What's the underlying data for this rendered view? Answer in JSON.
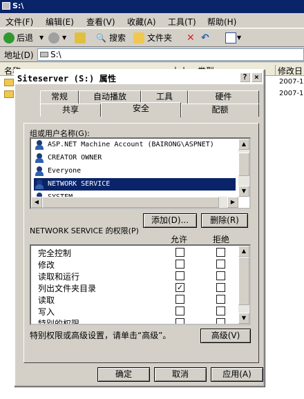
{
  "explorer": {
    "title": "S:\\",
    "menu": [
      "文件(F)",
      "编辑(E)",
      "查看(V)",
      "收藏(A)",
      "工具(T)",
      "帮助(H)"
    ],
    "toolbar": {
      "back": "后退",
      "search": "搜索",
      "folders": "文件夹"
    },
    "address_label": "地址(D)",
    "address_value": "S:\\",
    "columns": {
      "name": "名称",
      "size": "大小",
      "type": "类型",
      "modified": "修改日"
    },
    "rows": [
      {
        "modified": "2007-1"
      },
      {
        "modified": "2007-1"
      }
    ]
  },
  "dialog": {
    "title": "Siteserver (S:) 属性",
    "help_btn": "?",
    "close_btn": "×",
    "tabs_top": [
      "常规",
      "自动播放",
      "工具",
      "硬件"
    ],
    "tabs_bottom": [
      "共享",
      "安全",
      "配额"
    ],
    "active_tab": "安全",
    "group_label": "组或用户名称(G):",
    "users": [
      "ASP.NET Machine Account (BAIRONG\\ASPNET)",
      "CREATOR OWNER",
      "Everyone",
      "NETWORK SERVICE",
      "SYSTEM"
    ],
    "selected_user_index": 3,
    "add_button": "添加(D)...",
    "remove_button": "删除(R)",
    "perm_label": "NETWORK SERVICE 的权限(P)",
    "allow_header": "允许",
    "deny_header": "拒绝",
    "permissions": [
      {
        "name": "完全控制",
        "allow": false,
        "deny": false
      },
      {
        "name": "修改",
        "allow": false,
        "deny": false
      },
      {
        "name": "读取和运行",
        "allow": false,
        "deny": false
      },
      {
        "name": "列出文件夹目录",
        "allow": true,
        "deny": false
      },
      {
        "name": "读取",
        "allow": false,
        "deny": false
      },
      {
        "name": "写入",
        "allow": false,
        "deny": false
      },
      {
        "name": "特别的权限",
        "allow": false,
        "deny": false
      }
    ],
    "advanced_hint": "特别权限或高级设置，请单击“高级”。",
    "advanced_button": "高级(V)",
    "ok_button": "确定",
    "cancel_button": "取消",
    "apply_button": "应用(A)"
  }
}
